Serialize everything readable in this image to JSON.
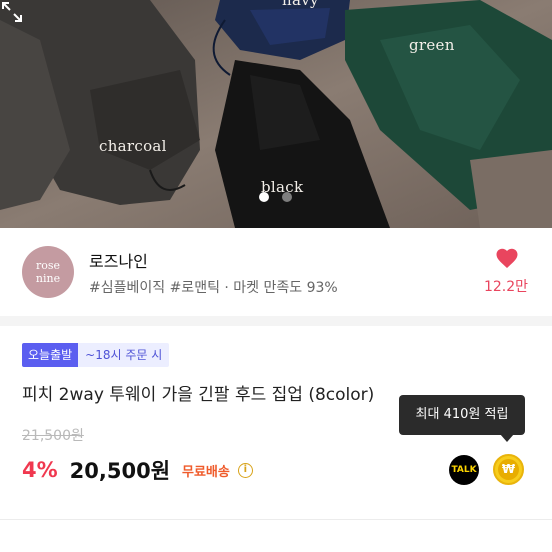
{
  "hero": {
    "color_labels": {
      "navy": "navy",
      "green": "green",
      "charcoal": "charcoal",
      "black": "black"
    },
    "carousel": {
      "current": 1,
      "total": 2
    },
    "expand_icon": "expand-icon"
  },
  "store": {
    "avatar_line1": "rose",
    "avatar_line2": "nine",
    "name": "로즈나인",
    "tags": "#심플베이직 #로맨틱 · 마켓 만족도 93%",
    "likes": "12.2만",
    "heart_icon": "heart-icon",
    "heart_color": "#e9455e"
  },
  "product": {
    "badge_today": "오늘출발",
    "badge_cutoff": "~18시 주문 시",
    "title": "피치 2way 투웨이 가을 긴팔 후드 집업 (8color)",
    "original_price": "21,500원",
    "discount": "4%",
    "price": "20,500원",
    "shipping": "무료배송",
    "info_icon": "i",
    "points_tooltip": "최대 410원 적립",
    "talk_label": "TALK",
    "won_symbol": "₩",
    "accent_color": "#f0384f"
  }
}
